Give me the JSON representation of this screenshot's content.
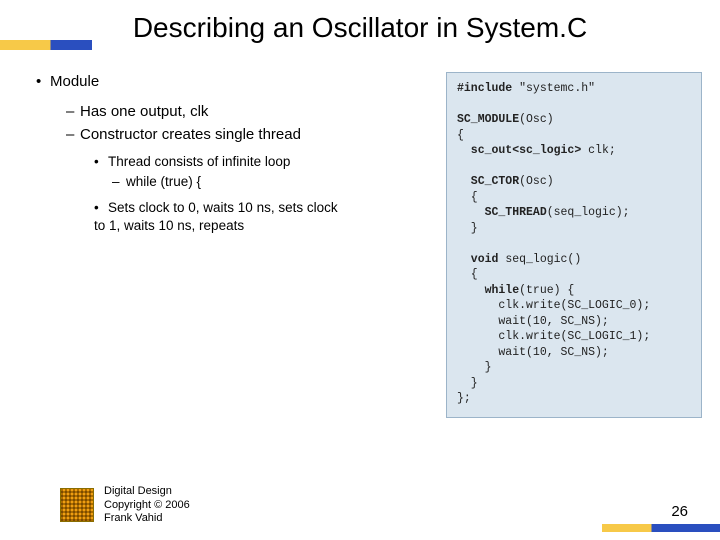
{
  "title": "Describing an Oscillator in System.C",
  "bullets": {
    "lvl1": "Module",
    "lvl2": [
      "Has one output, clk",
      "Constructor creates single thread"
    ],
    "lvl3a": "Thread consists of infinite loop",
    "lvl4a": "while (true) {",
    "lvl3b": "Sets clock to 0, waits 10 ns, sets clock to 1, waits 10 ns, repeats"
  },
  "code": {
    "l1a": "#include",
    "l1b": " \"systemc.h\"",
    "l2a": "SC_MODULE",
    "l2b": "(Osc)",
    "l3": "{",
    "l4a": "  sc_out<sc_logic>",
    "l4b": " clk;",
    "l5a": "  SC_CTOR",
    "l5b": "(Osc)",
    "l6": "  {",
    "l7a": "    SC_THREAD",
    "l7b": "(seq_logic);",
    "l8": "  }",
    "l9a": "  void",
    "l9b": " seq_logic()",
    "l10": "  {",
    "l11a": "    while",
    "l11b": "(true) {",
    "l12": "      clk.write(SC_LOGIC_0);",
    "l13": "      wait(10, SC_NS);",
    "l14": "      clk.write(SC_LOGIC_1);",
    "l15": "      wait(10, SC_NS);",
    "l16": "    }",
    "l17": "  }",
    "l18": "};"
  },
  "footer": {
    "line1": "Digital Design",
    "line2": "Copyright © 2006",
    "line3": "Frank Vahid"
  },
  "page": "26"
}
